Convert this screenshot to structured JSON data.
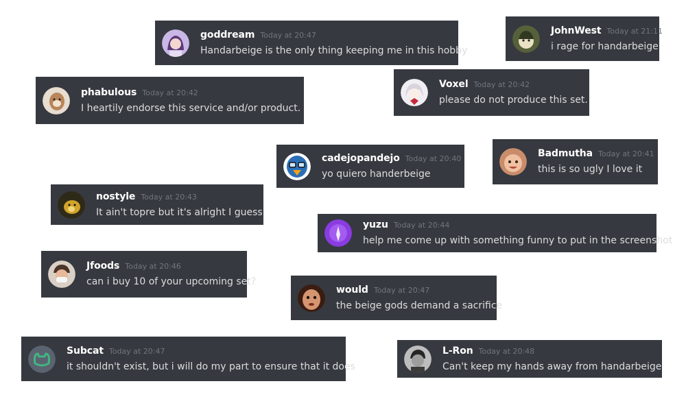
{
  "messages": [
    {
      "username": "goddream",
      "timestamp": "Today at 20:47",
      "text": "Handarbeige is the only thing keeping me in this hobby"
    },
    {
      "username": "JohnWest",
      "timestamp": "Today at 21:11",
      "text": "i rage for handarbeige"
    },
    {
      "username": "phabulous",
      "timestamp": "Today at 20:42",
      "text": "I heartily endorse this service and/or product."
    },
    {
      "username": "Voxel",
      "timestamp": "Today at 20:42",
      "text": "please do not produce this set."
    },
    {
      "username": "cadejopandejo",
      "timestamp": "Today at 20:40",
      "text": "yo quiero handerbeige"
    },
    {
      "username": "Badmutha",
      "timestamp": "Today at 20:41",
      "text": "this is so ugly I love it"
    },
    {
      "username": "nostyle",
      "timestamp": "Today at 20:43",
      "text": "It ain't topre but it's alright I guess"
    },
    {
      "username": "yuzu",
      "timestamp": "Today at 20:44",
      "text": "help me come up with something funny to put in the screenshot"
    },
    {
      "username": "Jfoods",
      "timestamp": "Today at 20:46",
      "text": "can i buy 10 of your upcoming set?"
    },
    {
      "username": "would",
      "timestamp": "Today at 20:47",
      "text": "the beige gods demand a sacrifice"
    },
    {
      "username": "Subcat",
      "timestamp": "Today at 20:47",
      "text": "it shouldn't exist, but i will do my part to ensure that it does"
    },
    {
      "username": "L-Ron",
      "timestamp": "Today at 20:48",
      "text": "Can't keep my hands away from handarbeige"
    }
  ]
}
